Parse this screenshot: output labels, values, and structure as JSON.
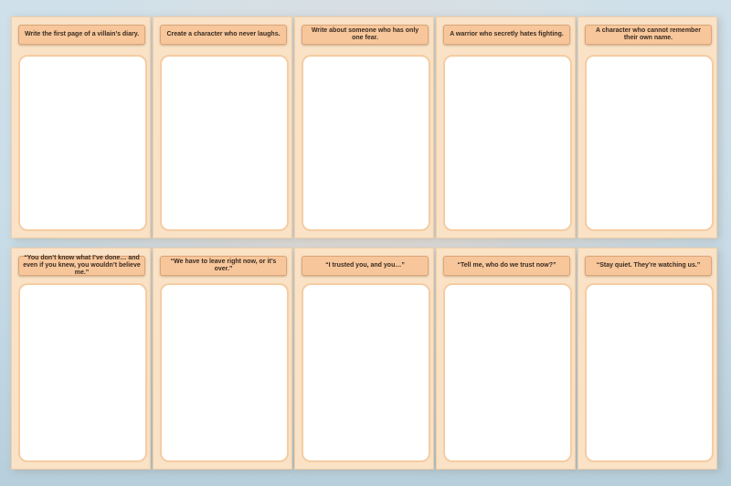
{
  "rows": [
    {
      "cards": [
        {
          "prompt": "Write the first page of a villain’s diary."
        },
        {
          "prompt": "Create a character who never laughs."
        },
        {
          "prompt": "Write about someone who has only one fear."
        },
        {
          "prompt": "A warrior who secretly hates fighting."
        },
        {
          "prompt": "A character who cannot remember their own name."
        }
      ]
    },
    {
      "cards": [
        {
          "prompt": "“You don’t know what I’ve done… and even if you knew, you wouldn’t believe me.”"
        },
        {
          "prompt": "“We have to leave right now, or it’s over.”"
        },
        {
          "prompt": "“I trusted you, and you…”"
        },
        {
          "prompt": "“Tell me, who do we trust now?”"
        },
        {
          "prompt": "“Stay quiet. They’re watching us.”"
        }
      ]
    }
  ],
  "colors": {
    "card": "#fae2c6",
    "prompt_bg": "#f7c79b",
    "box_border": "#f5cca2"
  }
}
